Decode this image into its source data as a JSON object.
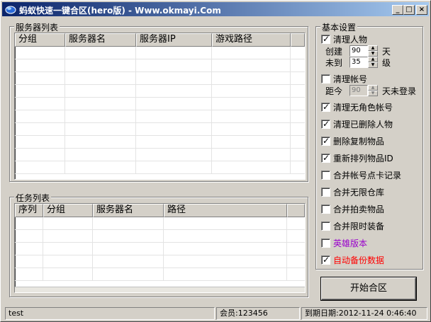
{
  "window": {
    "title": "蚂蚁快速一键合区(hero版) - Www.okmayi.Com",
    "minimize_glyph": "_",
    "maximize_glyph": "□",
    "close_glyph": "×"
  },
  "server_list": {
    "legend": "服务器列表",
    "columns": [
      "分组",
      "服务器名",
      "服务器IP",
      "游戏路径"
    ],
    "rows": []
  },
  "task_list": {
    "legend": "任务列表",
    "columns": [
      "序列",
      "分组",
      "服务器名",
      "路径"
    ],
    "rows": []
  },
  "settings": {
    "legend": "基本设置",
    "clean_characters": {
      "label": "清理人物",
      "checked": true
    },
    "created_days": {
      "label": "创建",
      "value": "90",
      "unit": "天"
    },
    "min_level": {
      "label": "未到",
      "value": "35",
      "unit": "级"
    },
    "clean_accounts": {
      "label": "清理帐号",
      "checked": false
    },
    "inactive_days": {
      "label": "距今",
      "value": "90",
      "unit": "天未登录"
    },
    "options": [
      {
        "label": "清理无角色帐号",
        "checked": true,
        "color": "#000000"
      },
      {
        "label": "清理已删除人物",
        "checked": true,
        "color": "#000000"
      },
      {
        "label": "删除复制物品",
        "checked": true,
        "color": "#000000"
      },
      {
        "label": "重新排列物品ID",
        "checked": true,
        "color": "#000000"
      },
      {
        "label": "合并帐号点卡记录",
        "checked": false,
        "color": "#000000"
      },
      {
        "label": "合并无限仓库",
        "checked": false,
        "color": "#000000"
      },
      {
        "label": "合并拍卖物品",
        "checked": false,
        "color": "#000000"
      },
      {
        "label": "合并限时装备",
        "checked": false,
        "color": "#000000"
      },
      {
        "label": "英雄版本",
        "checked": false,
        "color": "#9900cc"
      },
      {
        "label": "自动备份数据",
        "checked": true,
        "color": "#ff0000"
      }
    ],
    "check_mark": "✓"
  },
  "start_button": {
    "label": "开始合区"
  },
  "status": {
    "left": "test",
    "member": "会员:123456",
    "expiry": "到期日期:2012-11-24 0:46:40"
  }
}
